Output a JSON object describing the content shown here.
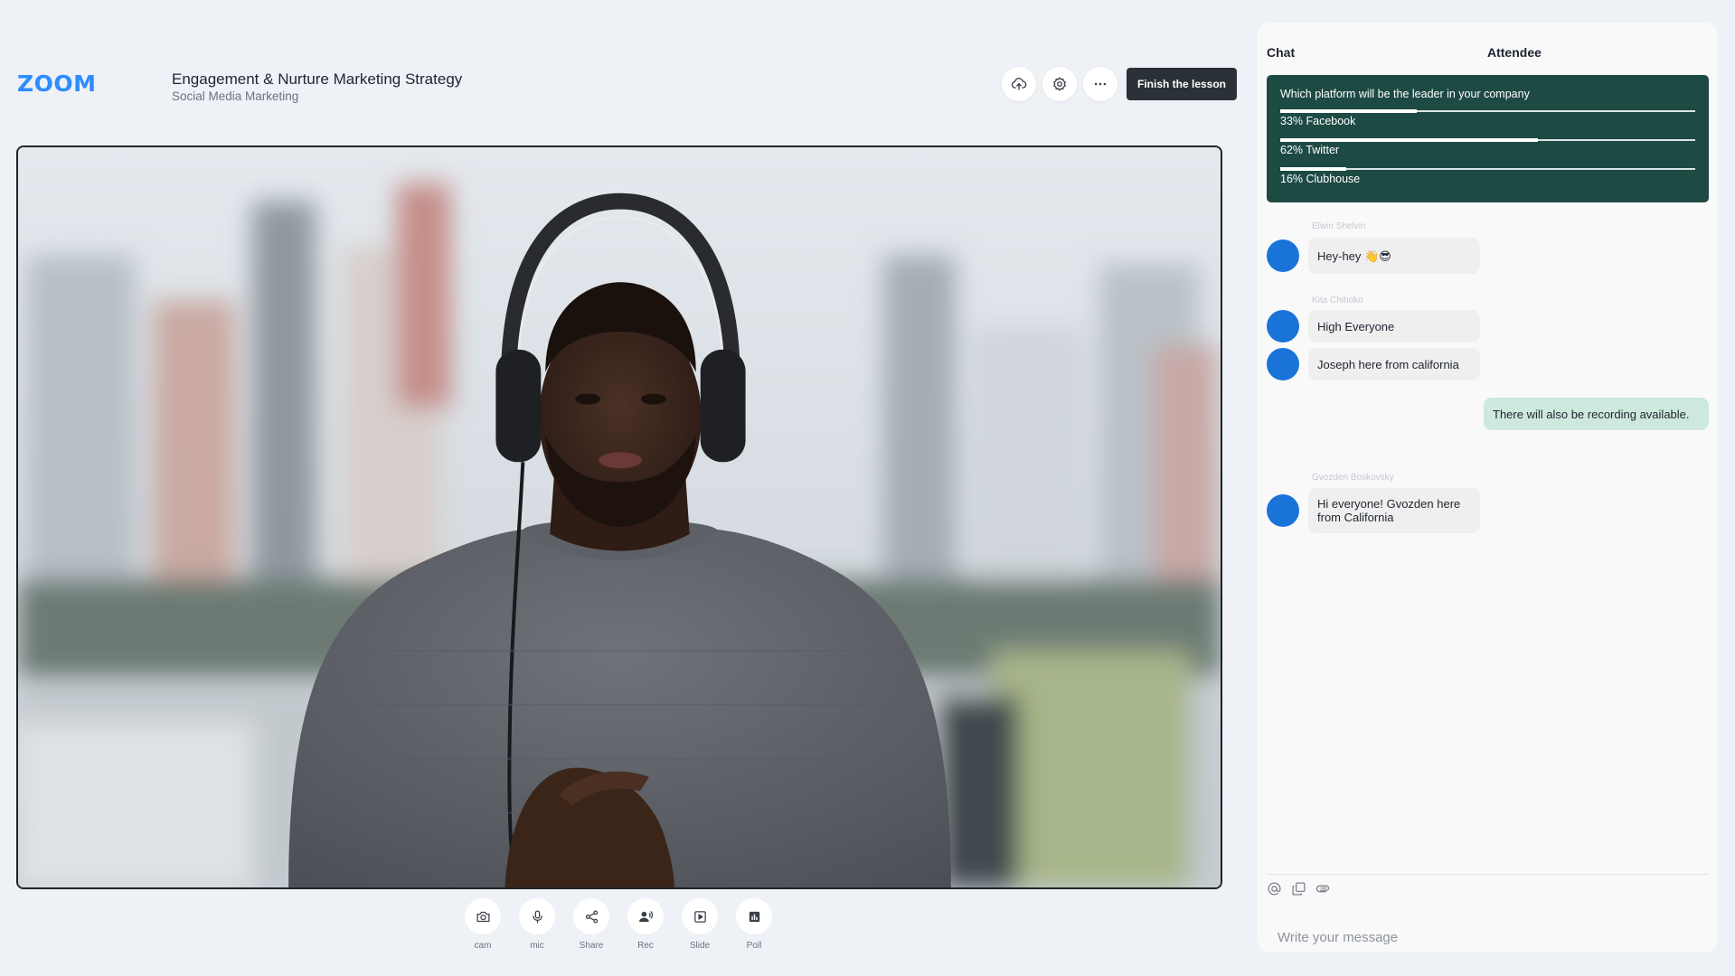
{
  "app": {
    "logo": "ZOOM"
  },
  "header": {
    "title": "Engagement & Nurture Marketing Strategy",
    "subtitle": "Social Media Marketing",
    "actions": [
      {
        "icon": "upload-cloud-icon"
      },
      {
        "icon": "gear-icon"
      },
      {
        "icon": "more-horizontal-icon"
      }
    ],
    "finish_label": "Finish the lesson"
  },
  "video": {
    "content": "presenter-webcam-feed"
  },
  "controls": [
    {
      "label": "cam",
      "icon": "camera-icon"
    },
    {
      "label": "mic",
      "icon": "mic-icon"
    },
    {
      "label": "Share",
      "icon": "share-icon"
    },
    {
      "label": "Rec",
      "icon": "record-icon"
    },
    {
      "label": "Slide",
      "icon": "slide-icon"
    },
    {
      "label": "Poll",
      "icon": "poll-icon"
    }
  ],
  "panel": {
    "tabs": {
      "chat": "Chat",
      "attendee": "Attendee"
    },
    "poll": {
      "question": "Which platform will be the leader in your company",
      "options": [
        {
          "text": "33% Facebook",
          "percent": 33
        },
        {
          "text": "62% Twitter",
          "percent": 62
        },
        {
          "text": "16% Clubhouse",
          "percent": 16
        }
      ]
    },
    "messages": {
      "m1_sender": "Elwin Shelvin",
      "m1_text": "Hey-hey 👋😎",
      "m2_sender": "Kita Chihoko",
      "m2_text": "High Everyone",
      "m3_text": "Joseph here from california",
      "m4_text": "There will also be recording available.",
      "m5_sender": "Gvozden Boskovsky",
      "m5_text_line1": "Hi everyone! Gvozden here",
      "m5_text_line2": "from California"
    },
    "composer": {
      "icons": [
        "at-icon",
        "copy-icon",
        "attachment-icon"
      ],
      "placeholder": "Write your message"
    }
  }
}
